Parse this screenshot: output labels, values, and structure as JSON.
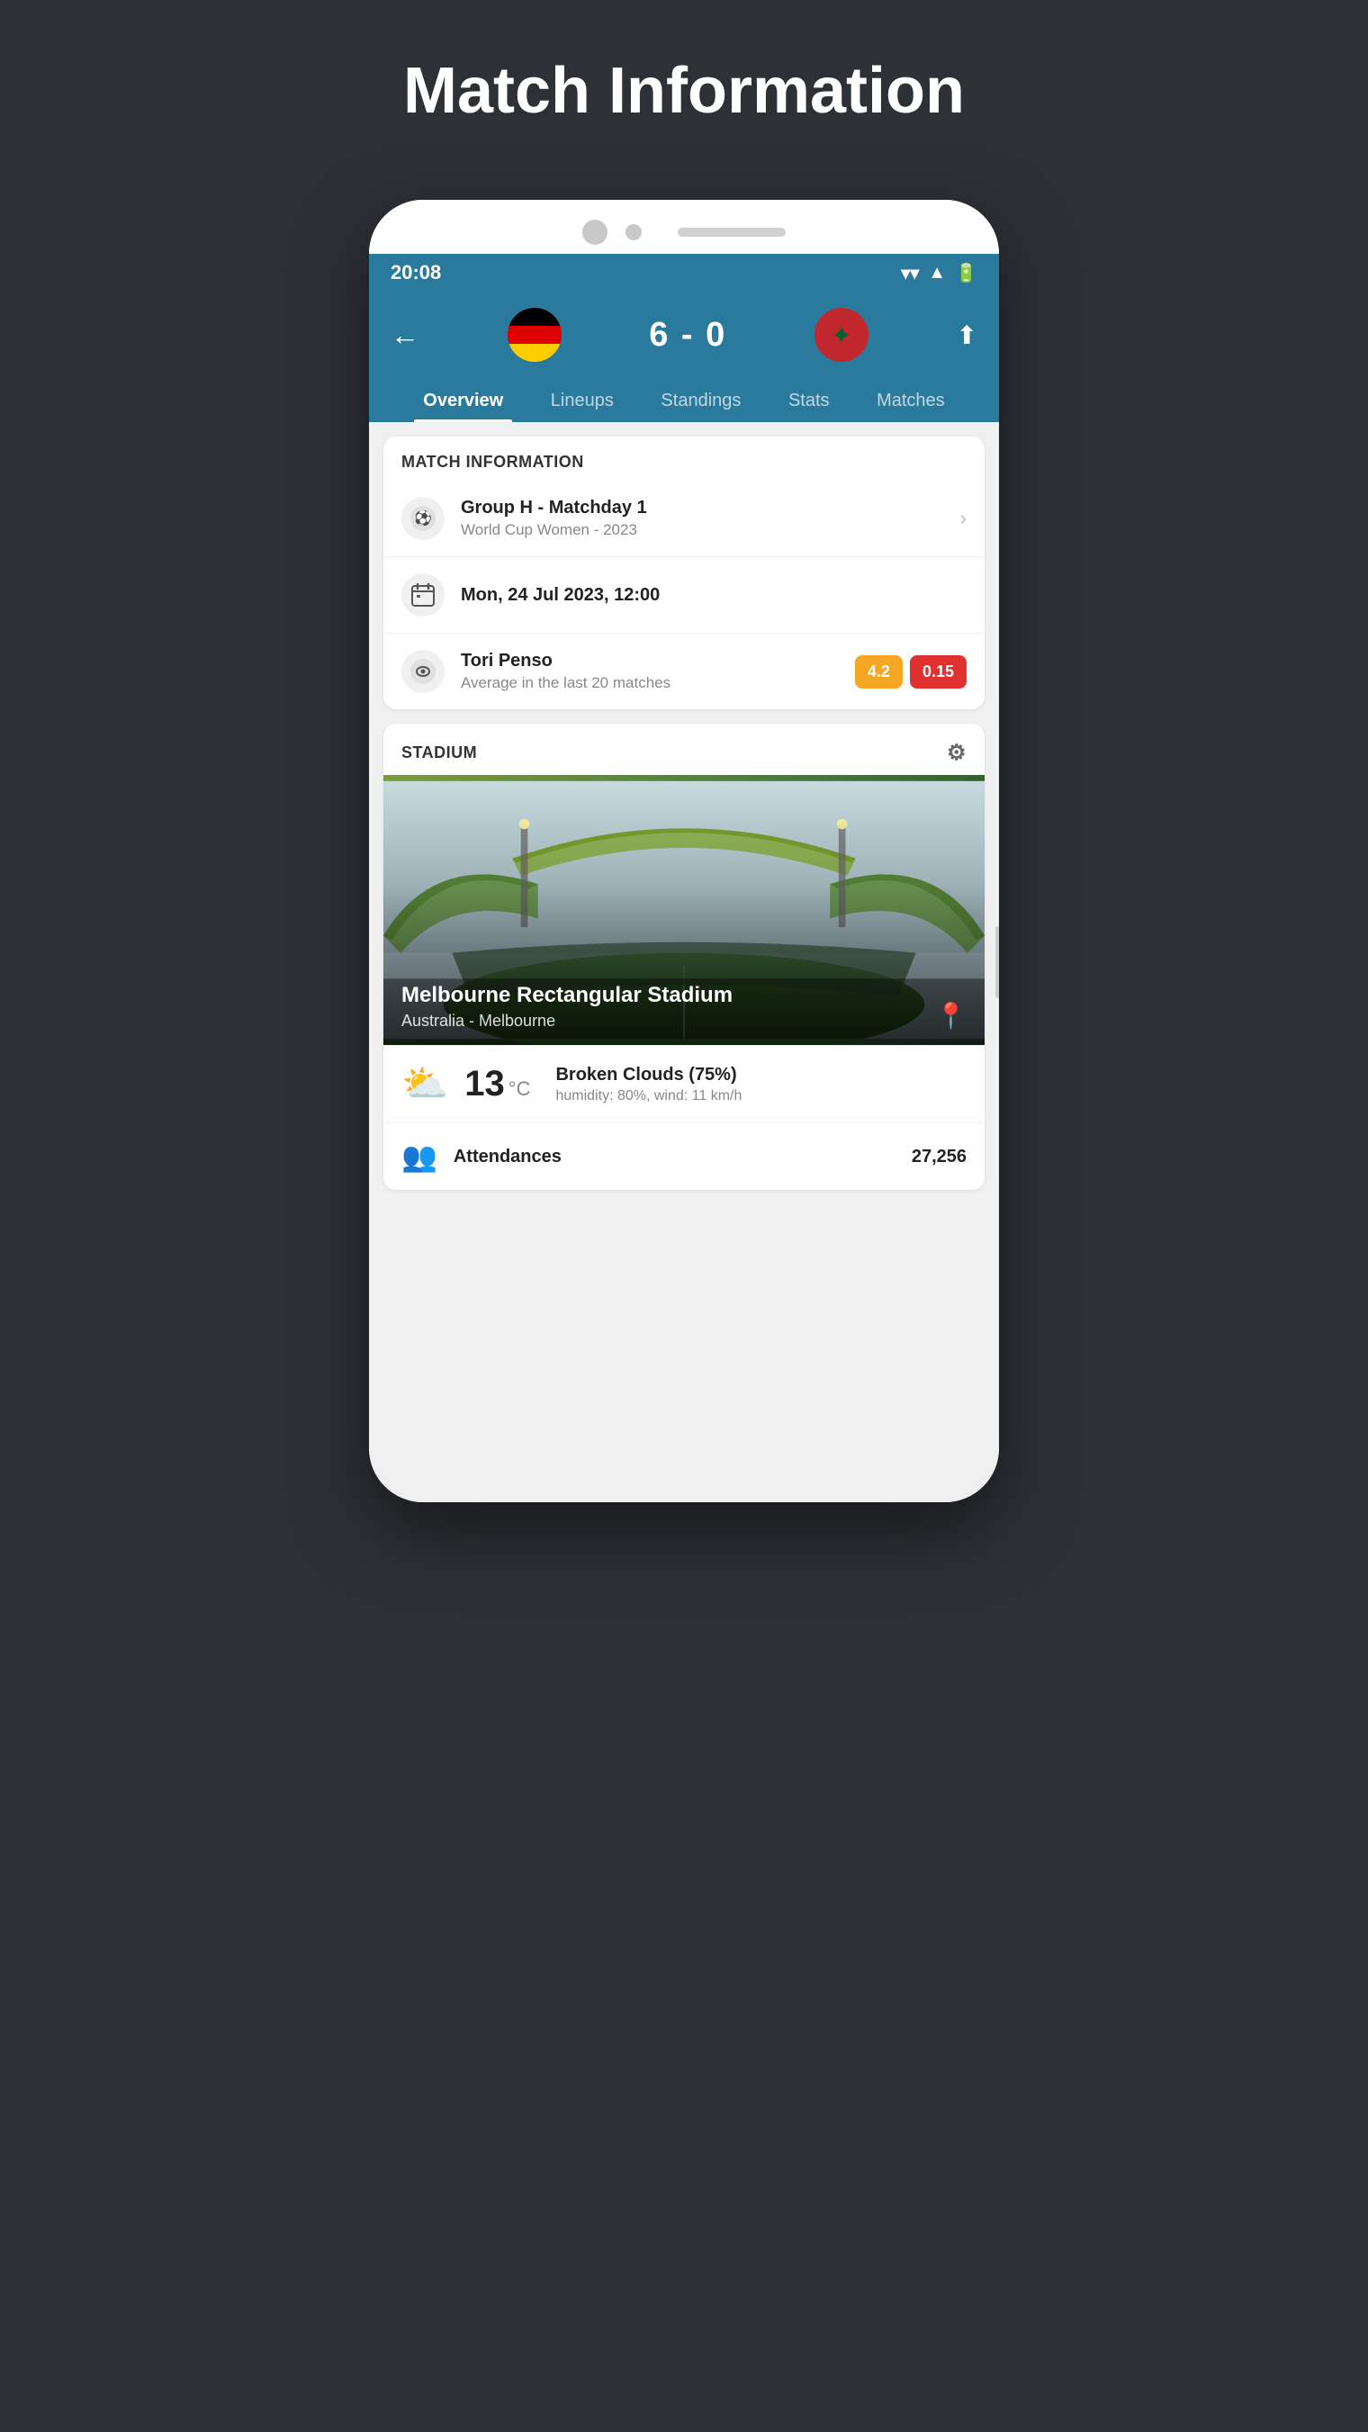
{
  "page": {
    "title": "Match Information"
  },
  "status_bar": {
    "time": "20:08",
    "icons": [
      "wifi",
      "signal",
      "battery"
    ]
  },
  "match_header": {
    "score": "6 - 0",
    "team_home": "Germany",
    "team_away": "Morocco",
    "back_label": "←",
    "share_label": "share"
  },
  "tabs": [
    {
      "label": "Overview",
      "active": true
    },
    {
      "label": "Lineups",
      "active": false
    },
    {
      "label": "Standings",
      "active": false
    },
    {
      "label": "Stats",
      "active": false
    },
    {
      "label": "Matches",
      "active": false
    }
  ],
  "match_info_section": {
    "title": "MATCH INFORMATION",
    "rows": [
      {
        "icon": "⚽",
        "title": "Group H - Matchday 1",
        "subtitle": "World Cup Women - 2023",
        "has_chevron": true
      },
      {
        "icon": "📅",
        "title": "Mon, 24 Jul 2023, 12:00",
        "subtitle": "",
        "has_chevron": false
      },
      {
        "icon": "👁",
        "title": "Tori Penso",
        "subtitle": "Average in the last 20 matches",
        "has_chevron": false,
        "badges": [
          {
            "value": "4.2",
            "color": "orange"
          },
          {
            "value": "0.15",
            "color": "red"
          }
        ]
      }
    ]
  },
  "stadium_section": {
    "title": "STADIUM",
    "name": "Melbourne Rectangular Stadium",
    "location": "Australia - Melbourne"
  },
  "weather": {
    "temperature": "13",
    "unit": "°C",
    "condition": "Broken Clouds (75%)",
    "detail": "humidity: 80%, wind: 11 km/h"
  },
  "attendance": {
    "label": "Attendances",
    "value": "27,256"
  }
}
